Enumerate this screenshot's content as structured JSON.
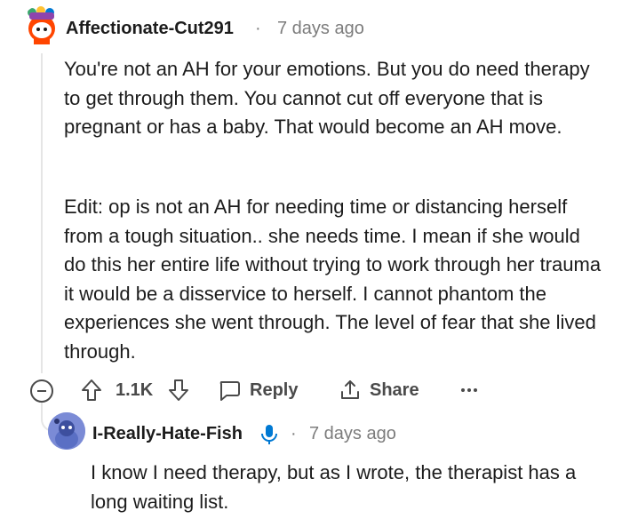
{
  "comment": {
    "author": "Affectionate-Cut291",
    "separator": "·",
    "timestamp": "7 days ago",
    "paragraphs": [
      "You're not an AH for your emotions. But you do need therapy to get through them. You cannot cut off everyone that is pregnant or has a baby. That would become an AH move.",
      "Edit: op is not an AH for needing time or distancing herself from a tough situation.. she needs time. I mean if she would do this her entire life without trying to work through her trauma it would be a disservice to herself. I cannot phantom the experiences she went through. The level of fear that she lived through."
    ]
  },
  "actions": {
    "score": "1.1K",
    "reply_label": "Reply",
    "share_label": "Share"
  },
  "reply": {
    "author": "I-Really-Hate-Fish",
    "separator": "·",
    "timestamp": "7 days ago",
    "text": "I know I need therapy, but as I wrote, the therapist has a long waiting list."
  },
  "icons": {
    "collapse": "collapse-icon",
    "upvote": "upvote-arrow-icon",
    "downvote": "downvote-arrow-icon",
    "reply": "speech-bubble-icon",
    "share": "share-icon",
    "more": "ellipsis-icon",
    "mic": "microphone-icon"
  },
  "colors": {
    "text": "#1c1c1c",
    "meta": "#7c7c7c",
    "action": "#4a4a4a",
    "mic": "#0079d3"
  }
}
